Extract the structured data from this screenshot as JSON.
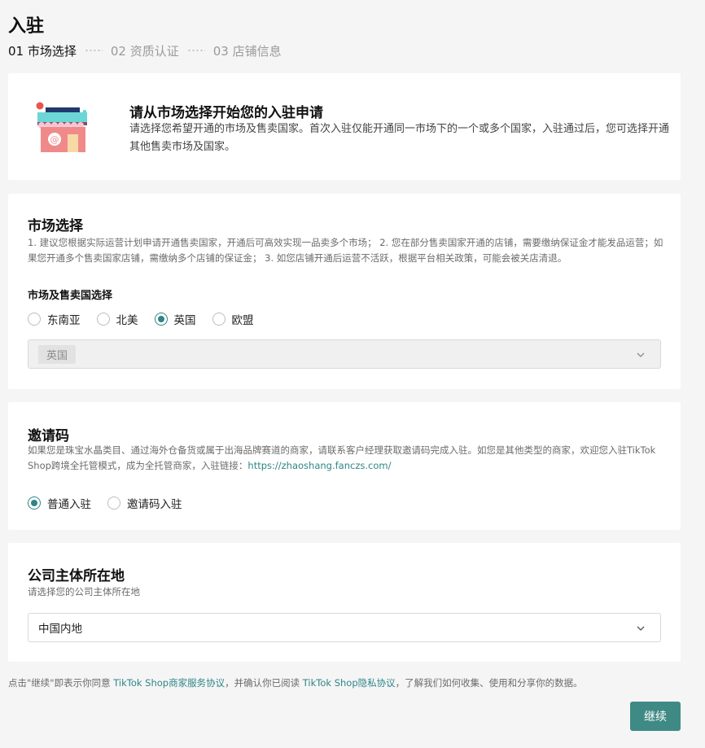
{
  "page": {
    "title": "入驻"
  },
  "steps": [
    {
      "label": "01 市场选择",
      "active": true
    },
    {
      "label": "02 资质认证",
      "active": false
    },
    {
      "label": "03 店铺信息",
      "active": false
    }
  ],
  "intro": {
    "icon": "shop-icon",
    "title": "请从市场选择开始您的入驻申请",
    "description": "请选择您希望开通的市场及售卖国家。首次入驻仅能开通同一市场下的一个或多个国家，入驻通过后，您可选择开通其他售卖市场及国家。"
  },
  "market": {
    "title": "市场选择",
    "description": "1. 建议您根据实际运营计划申请开通售卖国家，开通后可高效实现一品卖多个市场； 2. 您在部分售卖国家开通的店铺，需要缴纳保证金才能发品运营；如果您开通多个售卖国家店铺，需缴纳多个店铺的保证金； 3. 如您店铺开通后运营不活跃，根据平台相关政策，可能会被关店清退。",
    "sub_label": "市场及售卖国选择",
    "options": [
      "东南亚",
      "北美",
      "英国",
      "欧盟"
    ],
    "selected": "英国",
    "selected_tag": "英国"
  },
  "invite": {
    "title": "邀请码",
    "description": "如果您是珠宝水晶类目、通过海外仓备货或属于出海品牌赛道的商家，请联系客户经理获取邀请码完成入驻。如您是其他类型的商家，欢迎您入驻TikTok Shop跨境全托管模式，成为全托管商家，入驻链接：",
    "link": "https://zhaoshang.fanczs.com/",
    "options": [
      "普通入驻",
      "邀请码入驻"
    ],
    "selected": "普通入驻"
  },
  "company": {
    "title": "公司主体所在地",
    "description": "请选择您的公司主体所在地",
    "value": "中国内地"
  },
  "footer": {
    "note_prefix": "点击\"继续\"即表示你同意 ",
    "service_link": "TikTok Shop商家服务协议",
    "note_middle": "，并确认你已阅读 ",
    "privacy_link": "TikTok Shop隐私协议",
    "note_suffix": "，了解我们如何收集、使用和分享你的数据。",
    "continue_label": "继续"
  },
  "colors": {
    "accent": "#2f8585",
    "button": "#3f8a84",
    "background": "#f5f5f6"
  }
}
